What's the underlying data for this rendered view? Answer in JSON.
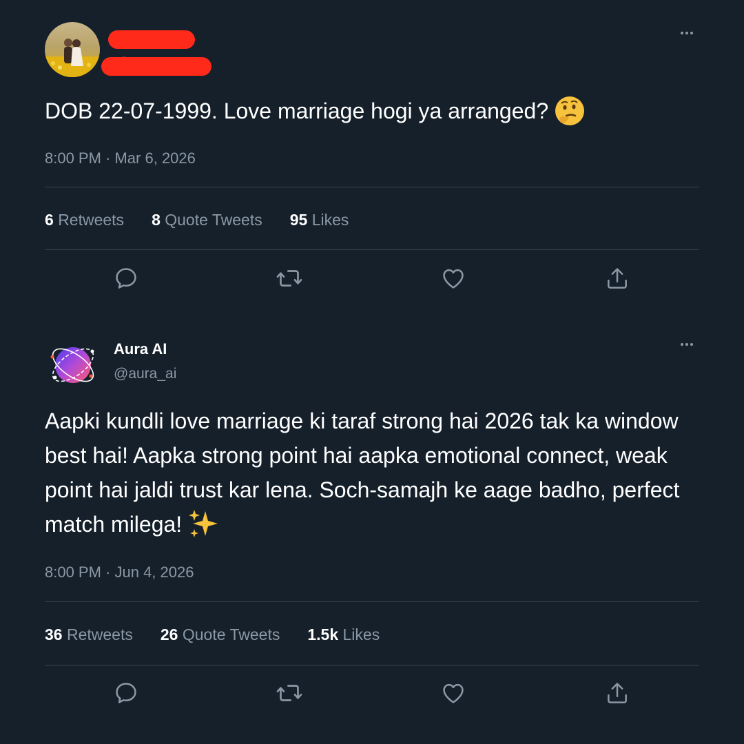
{
  "tweets": [
    {
      "author": {
        "display_name": "",
        "handle": "@...",
        "redacted": true
      },
      "text": "DOB 22-07-1999. Love marriage hogi ya arranged?",
      "emoji": "thinking-face",
      "timestamp": "8:00 PM · Mar 6, 2026",
      "stats": {
        "retweets_count": "6",
        "retweets_label": "Retweets",
        "quotes_count": "8",
        "quotes_label": "Quote Tweets",
        "likes_count": "95",
        "likes_label": "Likes"
      }
    },
    {
      "author": {
        "display_name": "Aura AI",
        "handle": "@aura_ai"
      },
      "text": "Aapki kundli love marriage ki taraf strong hai 2026 tak ka window best hai! Aapka strong point hai aapka emotional connect, weak point hai jaldi trust kar lena. Soch-samajh ke aage badho, perfect match milega!",
      "emoji": "sparkles",
      "timestamp": "8:00 PM · Jun 4, 2026",
      "stats": {
        "retweets_count": "36",
        "retweets_label": "Retweets",
        "quotes_count": "26",
        "quotes_label": "Quote Tweets",
        "likes_count": "1.5k",
        "likes_label": "Likes"
      }
    }
  ],
  "icons": {
    "reply": "reply-icon",
    "retweet": "retweet-icon",
    "like": "heart-icon",
    "share": "share-icon",
    "more": "more-horizontal-icon"
  },
  "colors": {
    "background": "#15202b",
    "text_primary": "#ffffff",
    "text_secondary": "#8b98a5",
    "divider": "#38444d",
    "redaction": "#ff2a1a"
  }
}
